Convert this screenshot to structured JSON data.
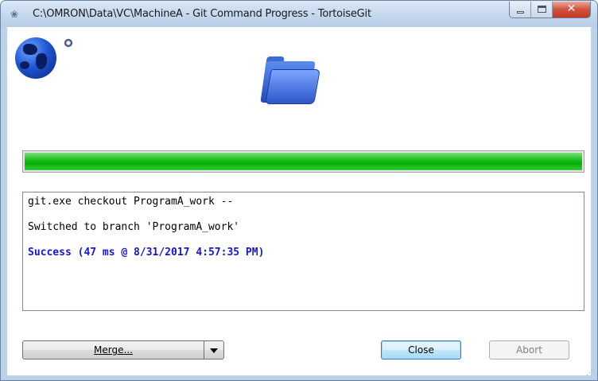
{
  "window": {
    "title": "C:\\OMRON\\Data\\VC\\MachineA - Git Command Progress - TortoiseGit",
    "app_icon": "tortoisegit-icon",
    "controls": {
      "minimize": "minimize-icon",
      "maximize": "maximize-icon",
      "close": "✕"
    }
  },
  "icons": {
    "left": "globe-icon",
    "center": "folder-icon"
  },
  "progress": {
    "percent": 100,
    "color": "#0fb40f"
  },
  "log": {
    "lines": [
      {
        "text": "git.exe checkout ProgramA_work --",
        "style": "normal"
      },
      {
        "text": "Switched to branch 'ProgramA_work'",
        "style": "normal"
      },
      {
        "text": "Success (47 ms @ 8/31/2017 4:57:35 PM)",
        "style": "success"
      }
    ],
    "success_color": "#1515d8"
  },
  "buttons": {
    "merge": "Merge...",
    "close": "Close",
    "abort": "Abort"
  }
}
